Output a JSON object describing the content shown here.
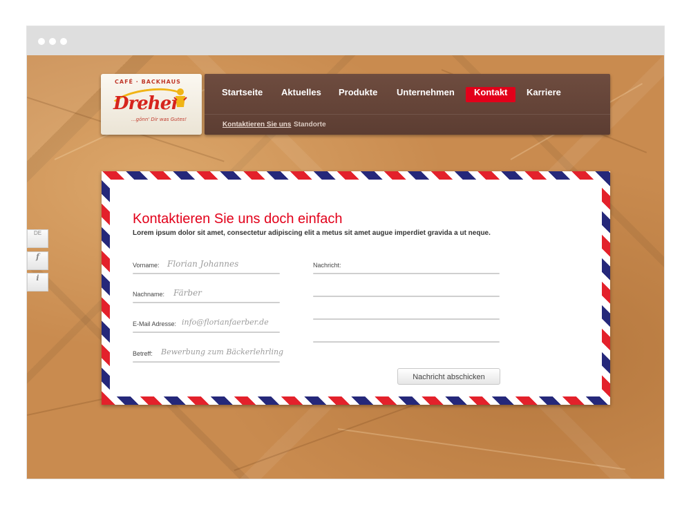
{
  "logo": {
    "top_text": "CAFÉ · BACKHAUS",
    "name": "Dreher",
    "tagline": "...gönn' Dir was Gutes!"
  },
  "nav": {
    "items": [
      {
        "label": "Startseite"
      },
      {
        "label": "Aktuelles"
      },
      {
        "label": "Produkte"
      },
      {
        "label": "Unternehmen"
      },
      {
        "label": "Kontakt",
        "active": true
      },
      {
        "label": "Karriere"
      }
    ],
    "sub_items": [
      {
        "label": "Kontaktieren Sie uns",
        "active": true
      },
      {
        "label": "Standorte"
      }
    ]
  },
  "side": {
    "lang": "DE",
    "facebook_icon": "f",
    "info_icon": "i"
  },
  "contact": {
    "title": "Kontaktieren Sie uns doch einfach",
    "intro": "Lorem ipsum dolor sit amet, consectetur adipiscing elit a metus sit amet augue imperdiet gravida a ut neque.",
    "fields": [
      {
        "label": "Vorname:",
        "value": "Florian Johannes"
      },
      {
        "label": "Nachname:",
        "value": "Färber"
      },
      {
        "label": "E-Mail Adresse:",
        "value": "info@florianfaerber.de"
      },
      {
        "label": "Betreff:",
        "value": "Bewerbung zum Bäckerlehrling"
      }
    ],
    "message_label": "Nachricht:",
    "submit_label": "Nachricht abschicken"
  },
  "colors": {
    "accent_red": "#e2001a",
    "nav_brown": "#634236",
    "stripe_red": "#e3212b",
    "stripe_blue": "#25287a",
    "paper": "#c98b4f"
  }
}
